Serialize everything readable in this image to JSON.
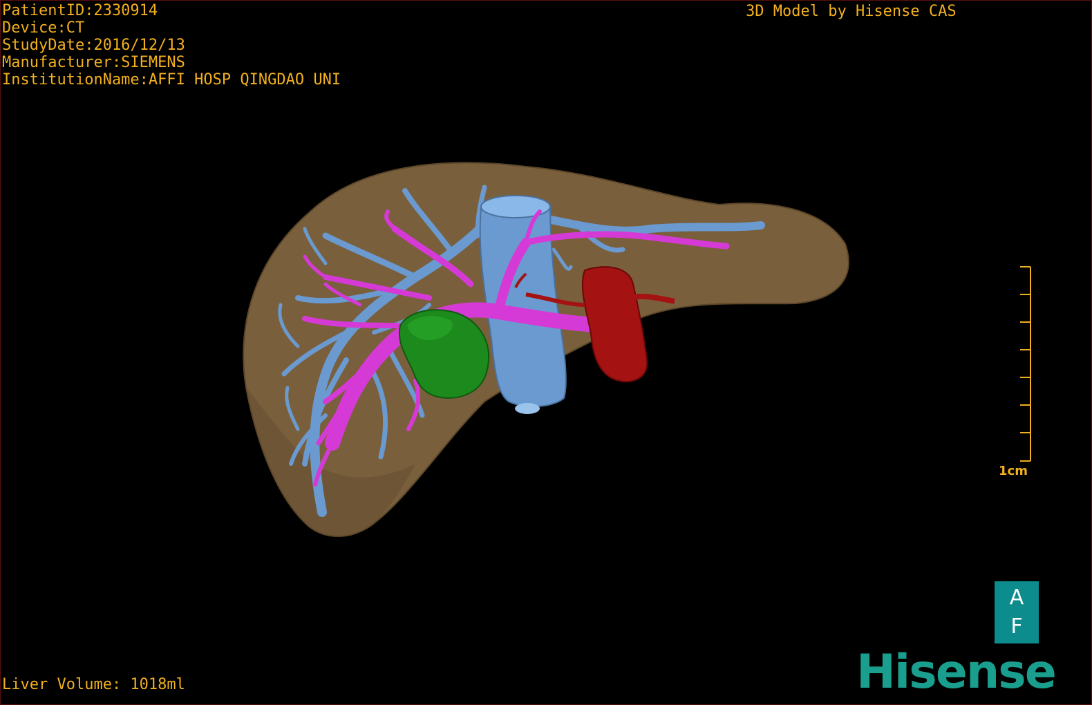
{
  "overlay": {
    "patient_id": "PatientID:2330914",
    "device": "Device:CT",
    "study_date": "StudyDate:2016/12/13",
    "manufacturer": "Manufacturer:SIEMENS",
    "institution": "InstitutionName:AFFI HOSP QINGDAO UNI",
    "watermark": "3D Model by Hisense CAS",
    "liver_volume": "Liver Volume: 1018ml"
  },
  "scale_bar": {
    "label": "1cm",
    "color": "#f2b01e"
  },
  "orientation_cube": {
    "top": "A",
    "bottom": "F",
    "color": "#0c8c8c"
  },
  "brand": {
    "logo": "Hisense",
    "color": "#1a9e8e"
  },
  "model_colors": {
    "liver": "#7a5f3c",
    "hepatic_vein": "#6a9ad0",
    "portal_vein": "#d63ad6",
    "tumor": "#1c8a1c",
    "artery": "#a41212"
  }
}
